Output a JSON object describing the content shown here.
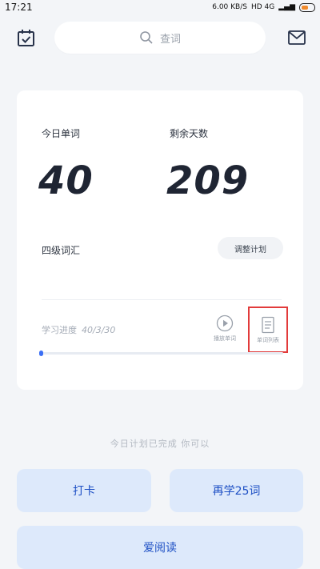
{
  "status_bar": {
    "time": "17:21",
    "net_speed": "6.00 KB/S",
    "network": "HD 4G"
  },
  "search": {
    "placeholder": "查词"
  },
  "stats": {
    "today_label": "今日单词",
    "today_value": "40",
    "remaining_label": "剩余天数",
    "remaining_value": "209"
  },
  "plan": {
    "book_title": "四级词汇",
    "adjust_label": "调整计划"
  },
  "progress": {
    "label": "学习进度",
    "value": "40/3/30",
    "fraction": 0.01
  },
  "actions": {
    "review_label": "播放单词",
    "wordlist_label": "单词列表",
    "done_message": "今日计划已完成 你可以",
    "checkin_label": "打卡",
    "learn_more_label": "再学25词",
    "read_label": "爱阅读"
  },
  "colors": {
    "accent": "#3b6ff5",
    "highlight_box": "#e23b3b",
    "button_bg": "#dde9fb"
  }
}
